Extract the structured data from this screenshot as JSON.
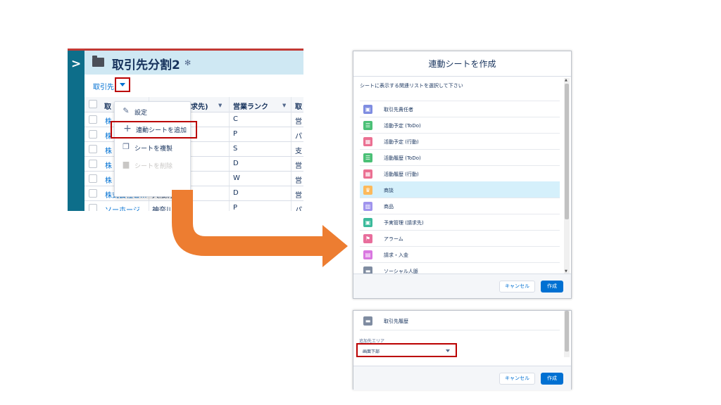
{
  "app": {
    "title": "取引先分割2",
    "tab_label": "取引先",
    "columns": {
      "c1": "取",
      "c3": "請求先)",
      "c4": "営業ランク",
      "c5": "取"
    },
    "rows": [
      {
        "name": "株",
        "city": "",
        "rank": "C",
        "last": "営"
      },
      {
        "name": "株",
        "city": "",
        "rank": "P",
        "last": "パ"
      },
      {
        "name": "株",
        "city": "",
        "rank": "S",
        "last": "支"
      },
      {
        "name": "株",
        "city": "",
        "rank": "D",
        "last": "営"
      },
      {
        "name": "株",
        "city": "",
        "rank": "W",
        "last": "営"
      },
      {
        "name": "株式会社ビ...",
        "city": "大阪府",
        "rank": "D",
        "last": "営"
      },
      {
        "name": "ソーホージ...",
        "city": "神奈川",
        "rank": "P",
        "last": "パ"
      }
    ]
  },
  "menu": {
    "items": [
      {
        "label": "設定",
        "icon": "pencil-icon"
      },
      {
        "label": "連動シートを追加",
        "icon": "plus-icon"
      },
      {
        "label": "シートを複製",
        "icon": "copy-icon"
      },
      {
        "label": "シートを削除",
        "icon": "trash-icon"
      }
    ]
  },
  "modal": {
    "title": "連動シートを作成",
    "subtitle": "シートに表示する関連リストを選択して下さい",
    "items": [
      {
        "label": "取引先責任者",
        "color": "#7f8de1"
      },
      {
        "label": "活動予定 (ToDo)",
        "color": "#4bc076"
      },
      {
        "label": "活動予定 (行動)",
        "color": "#eb7092"
      },
      {
        "label": "活動履歴 (ToDo)",
        "color": "#4bc076"
      },
      {
        "label": "活動履歴 (行動)",
        "color": "#eb7092"
      },
      {
        "label": "商談",
        "color": "#fcb95b"
      },
      {
        "label": "商品",
        "color": "#a094ed"
      },
      {
        "label": "予実管理 (請求先)",
        "color": "#3bba9b"
      },
      {
        "label": "アラーム",
        "color": "#e86e9c"
      },
      {
        "label": "請求・入金",
        "color": "#d977e0"
      },
      {
        "label": "ソーシャル人脈",
        "color": "#7f8ca1"
      }
    ],
    "cancel_label": "キャンセル",
    "ok_label": "作成"
  },
  "modal2": {
    "item_label": "取引先履歴",
    "area_label": "追加先エリア",
    "area_value": "画面下部",
    "cancel_label": "キャンセル",
    "ok_label": "作成"
  },
  "colors": {
    "accent": "#0070d2",
    "highlight_border": "#bb0000",
    "arrow": "#ed7d31",
    "rail": "#0d6e8a",
    "header_bg": "#cfe8f3",
    "selected_row": "#d5f0fb"
  }
}
